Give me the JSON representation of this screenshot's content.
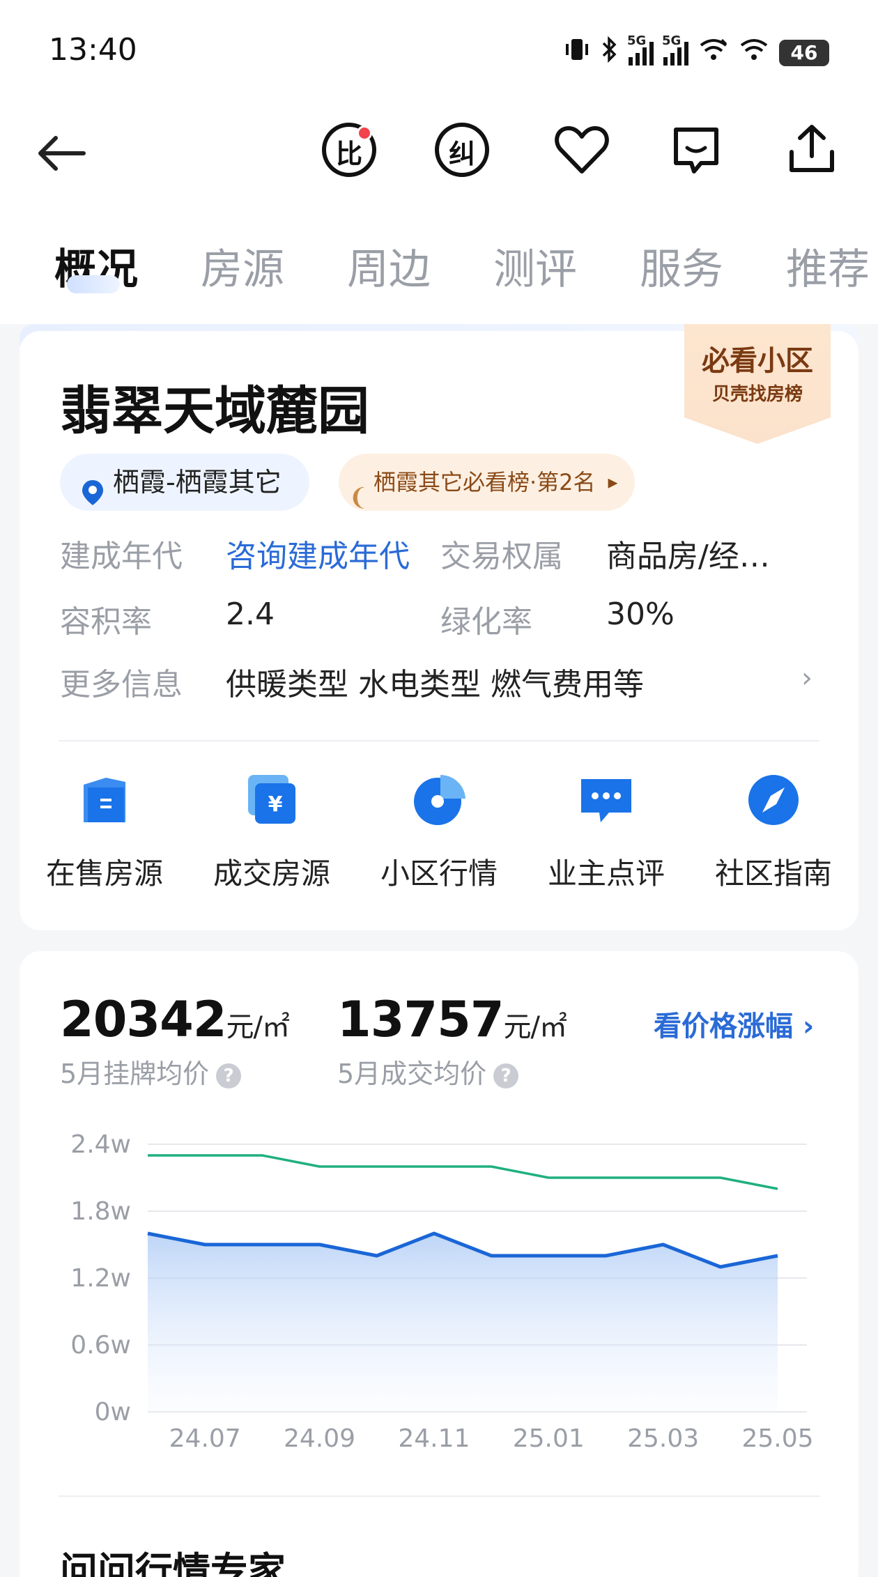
{
  "status_bar": {
    "time": "13:40",
    "network_label_1": "5G",
    "network_label_2": "5G",
    "battery": "46"
  },
  "header": {
    "icons": [
      "back-arrow-icon",
      "compare-icon",
      "correct-icon",
      "heart-icon",
      "chat-icon",
      "share-icon"
    ],
    "compare_label": "比",
    "correct_label": "纠"
  },
  "tabs": [
    {
      "label": "概况",
      "active": true
    },
    {
      "label": "房源",
      "active": false
    },
    {
      "label": "周边",
      "active": false
    },
    {
      "label": "测评",
      "active": false
    },
    {
      "label": "服务",
      "active": false
    },
    {
      "label": "推荐",
      "active": false
    }
  ],
  "estate": {
    "name": "翡翠天域麓园",
    "badge_title": "必看小区",
    "badge_subtitle": "贝壳找房榜",
    "location": "栖霞-栖霞其它",
    "rank": "栖霞其它必看榜·第2名",
    "info": [
      {
        "label": "建成年代",
        "value": "咨询建成年代",
        "is_link": true
      },
      {
        "label": "交易权属",
        "value": "商品房/经…",
        "is_link": false
      },
      {
        "label": "容积率",
        "value": "2.4",
        "is_link": false
      },
      {
        "label": "绿化率",
        "value": "30%",
        "is_link": false
      },
      {
        "label": "更多信息",
        "value": "供暖类型 水电类型 燃气费用等",
        "is_link": false
      }
    ],
    "more_arrow": "›"
  },
  "entries": [
    {
      "label": "在售房源",
      "icon": "listing-icon"
    },
    {
      "label": "成交房源",
      "icon": "deal-icon"
    },
    {
      "label": "小区行情",
      "icon": "market-pie-icon"
    },
    {
      "label": "业主点评",
      "icon": "comment-icon"
    },
    {
      "label": "社区指南",
      "icon": "compass-icon"
    }
  ],
  "prices": {
    "listing_value": "20342",
    "listing_unit": "元/㎡",
    "listing_label": "5月挂牌均价",
    "deal_value": "13757",
    "deal_unit": "元/㎡",
    "deal_label": "5月成交均价",
    "help": "?",
    "link": "看价格涨幅 ›"
  },
  "chart_data": {
    "type": "line",
    "x": [
      "24.06",
      "24.07",
      "24.08",
      "24.09",
      "24.10",
      "24.11",
      "24.12",
      "25.01",
      "25.02",
      "25.03",
      "25.04",
      "25.05"
    ],
    "x_tick_labels": [
      "24.07",
      "24.09",
      "24.11",
      "25.01",
      "25.03",
      "25.05"
    ],
    "y_tick_labels": [
      "2.4w",
      "1.8w",
      "1.2w",
      "0.6w",
      "0w"
    ],
    "ylim": [
      0,
      2.4
    ],
    "y_unit": "w",
    "grid": true,
    "series": [
      {
        "values": [
          2.3,
          2.3,
          2.3,
          2.2,
          2.2,
          2.2,
          2.2,
          2.1,
          2.1,
          2.1,
          2.1,
          2.0
        ],
        "color": "#1fb07e"
      },
      {
        "values": [
          1.6,
          1.5,
          1.5,
          1.5,
          1.4,
          1.6,
          1.4,
          1.4,
          1.4,
          1.5,
          1.3,
          1.4
        ],
        "color": "#1a66d6",
        "area": true
      }
    ]
  },
  "next_section": {
    "title": "问问行情专家"
  }
}
